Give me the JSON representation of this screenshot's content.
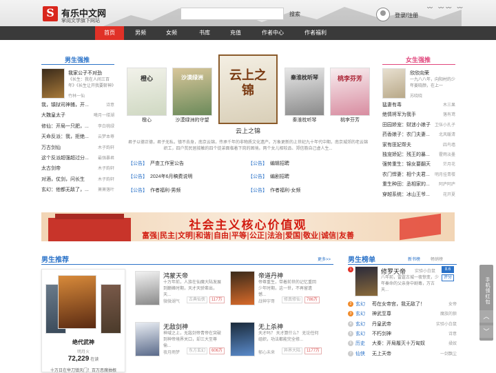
{
  "header": {
    "logo_mark": "S",
    "site_title": "有乐中文网",
    "site_sub": "掌阅文学旗下网站",
    "search_placeholder": "",
    "search_label": "搜索",
    "login_label": "登录/注册",
    "birds": "〰 〰〰 〰"
  },
  "nav": [
    "首页",
    "男频",
    "女频",
    "书库",
    "充值",
    "作者中心",
    "作者福利"
  ],
  "male_strong": {
    "title": "男生强推",
    "feature": {
      "title": "我家公子不对劲",
      "desc": "《长生：我在人间三百年》《长生让开我要斩神》",
      "author": "竹林一仙"
    },
    "items": [
      {
        "name": "我，镇狱司神捕，开...",
        "author": "诗意"
      },
      {
        "name": "大魏皇太子",
        "author": "曦月一缕湖"
      },
      {
        "name": "修仙：开局一只肥，...",
        "author": "李白桃绿"
      },
      {
        "name": "天命反派：我，拒绝...",
        "author": "云梦本尊"
      },
      {
        "name": "万古剑仙",
        "author": "木子韵轩"
      },
      {
        "name": "这个反派超强超过分...",
        "author": "最强暴君"
      },
      {
        "name": "太古剑帝",
        "author": "木子韵轩"
      },
      {
        "name": "对酒，仗剑，问长生",
        "author": "木子韵轩"
      },
      {
        "name": "玄幻：他都无敌了，...",
        "author": "萧萧落叶"
      }
    ]
  },
  "female_strong": {
    "title": "女生强推",
    "feature": {
      "title": "欣欣向荣",
      "desc": "一九八八年，向阳村的少年姜晓颜，在上一",
      "author": "苏晓晓"
    },
    "items": [
      {
        "name": "猛妻有毒",
        "author": "木三果"
      },
      {
        "name": "绝情将军为我手",
        "author": "落有鸢"
      },
      {
        "name": "田园娇宠：财迷小娘子",
        "author": "卫伍小孔子"
      },
      {
        "name": "药香娘子：农门夫妻...",
        "author": "北风暖清"
      },
      {
        "name": "家有匪妃帮夫",
        "author": "四鸟墙"
      },
      {
        "name": "独宠娇妃：残王的暴...",
        "author": "霍雨淡墨"
      },
      {
        "name": "强势重生：锦女要翻天",
        "author": "茫月花"
      },
      {
        "name": "农门悍妻：相个夫君...",
        "author": "明月挂青楼"
      },
      {
        "name": "重生种田：丞相家的...",
        "author": "阿庐阿庐"
      },
      {
        "name": "穿越系统：冰山王爷...",
        "author": "花开夏"
      }
    ]
  },
  "carousel": {
    "covers": [
      {
        "caption": "橙心",
        "title": "橙心"
      },
      {
        "caption": "沙漠绿洲的守望",
        "title": "沙漠绿洲"
      },
      {
        "caption": "",
        "title": "云上之锦"
      },
      {
        "caption": "秦淮枕听琴",
        "title": "秦淮枕听琴"
      },
      {
        "caption": "桃李芬芳",
        "title": "桃李芬芳"
      }
    ],
    "active_title": "云上之锦",
    "desc": "君子以德正德，君子无私，镇不去身，南京云锦，传承千年的非物质文化遗产。万象更新的上世纪九十年代中期，南京城郊的老云锦织工，四户贫民居接触的四个徒弟面临着下岗的困境。两个女儿相较品、郑信筋自己虚人生..."
  },
  "notices": [
    {
      "tag": "【公告】",
      "text": "严查工作室公告"
    },
    {
      "tag": "【公告】",
      "text": "编辑招聘"
    },
    {
      "tag": "【公告】",
      "text": "2024年6月稿费说明"
    },
    {
      "tag": "【公告】",
      "text": "编剧招聘"
    },
    {
      "tag": "【公告】",
      "text": "作者福利-男频"
    },
    {
      "tag": "【公告】",
      "text": "作者福利-女频"
    }
  ],
  "banner": {
    "title": "社会主义核心价值观",
    "sub": "富强|民主|文明|和谐|自由|平等|公正|法治|爱国|敬业|诚信|友善"
  },
  "male_rec": {
    "title": "男生推荐",
    "more": "更多>>",
    "feature": {
      "title": "绝代武神",
      "author": "明月火",
      "count": "72,229",
      "count_unit": "在读",
      "desc": "十万日在举刀镇天门！百万恶魔抽根"
    },
    "books": [
      {
        "title": "鸿蒙天帝",
        "desc": "十万年前，人族在仙魔大陆发展到巅峰时期，天才天骄辈出，天...",
        "author": "微微湖气",
        "genre": "古典仙侠",
        "count": "117万"
      },
      {
        "title": "帝道丹神",
        "desc": "帝尊重生，带着前世的记忆重回少年时期，这一世，不再留遗憾...",
        "author": "战神宇哥",
        "genre": "修真修仙",
        "count": "786万"
      },
      {
        "title": "无敌剑神",
        "desc": "神域之上，无敌剑帝青帝在突破到神帝境界关口，却三大至尊偷...",
        "author": "夜月雨梦",
        "genre": "东方玄幻",
        "count": "606万"
      },
      {
        "title": "无上杀神",
        "desc": "天才吗？ 天才算什么？ 无论任何组织，功法都能完全修...",
        "author": "郁心未来",
        "genre": "异界大陆",
        "count": "1177万"
      }
    ]
  },
  "male_rank": {
    "title": "男生榜单",
    "tabs": [
      "新书榜",
      "畅销榜"
    ],
    "top": {
      "title": "修罗天帝",
      "author": "实验小白鼠",
      "desc": "八年前，雷霆古城一夜惊变，少年秦命的父亲身中剧毒，万古天...",
      "score": "8.6",
      "score_label": "评分"
    },
    "items": [
      {
        "cat": "玄幻",
        "name": "苟在女帝宫，我无敌了！",
        "author": "女帝"
      },
      {
        "cat": "玄幻",
        "name": "神武至尊",
        "author": "魔族的狼"
      },
      {
        "cat": "玄幻",
        "name": "丹皇武帝",
        "author": "实验小白鼠"
      },
      {
        "cat": "玄幻",
        "name": "不朽剑神",
        "author": "诗意"
      },
      {
        "cat": "历史",
        "name": "大秦：开局履灭十万匈奴",
        "author": "揉奴"
      },
      {
        "cat": "仙侠",
        "name": "无上天帝",
        "author": "一剑飘尘"
      }
    ]
  },
  "side": {
    "label": "手机领红包",
    "up": "︿",
    "down": "﹀"
  },
  "colors": {
    "accent": "#e03127",
    "male": "#2a72c8",
    "female": "#e0457b",
    "nav": "#3a3a3a"
  }
}
